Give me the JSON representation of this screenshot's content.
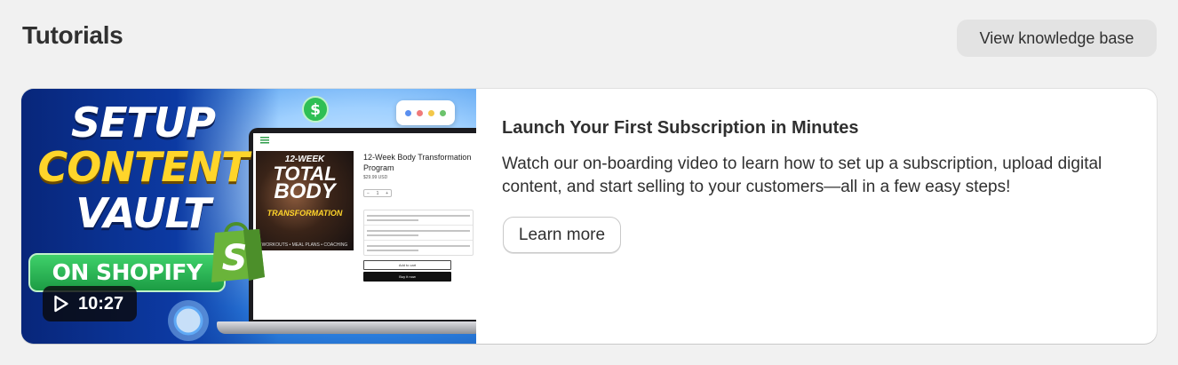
{
  "header": {
    "title": "Tutorials",
    "knowledge_base_label": "View knowledge base"
  },
  "tutorial": {
    "title": "Launch Your First Subscription in Minutes",
    "description": "Watch our on-boarding video to learn how to set up a subscription, upload digital content, and start selling to your customers—all in a few easy steps!",
    "cta_label": "Learn more",
    "thumbnail": {
      "headline_1": "SETUP",
      "headline_2": "CONTENT",
      "headline_3": "VAULT",
      "platform": "ON SHOPIFY",
      "duration": "10:27",
      "mock_product": {
        "poster_line_1": "12-WEEK",
        "poster_line_2": "TOTAL",
        "poster_line_3": "BODY",
        "poster_line_4": "TRANSFORMATION",
        "poster_footer": "WORKOUTS • MEAL PLANS • COACHING",
        "title": "12-Week Body Transformation Program",
        "price": "$29.99 USD",
        "add_to_cart": "Add to cart",
        "buy_now": "Buy it now"
      },
      "icons": [
        "play-icon",
        "shopify-bag-icon",
        "dollar-coin-icon",
        "menu-icon"
      ]
    }
  },
  "colors": {
    "page_background": "#f1f1f1",
    "card_background": "#ffffff",
    "secondary_button": "#e3e3e3",
    "text": "#303030",
    "headline_yellow": "#ffd52a",
    "shopify_green": "#1c9c44"
  }
}
